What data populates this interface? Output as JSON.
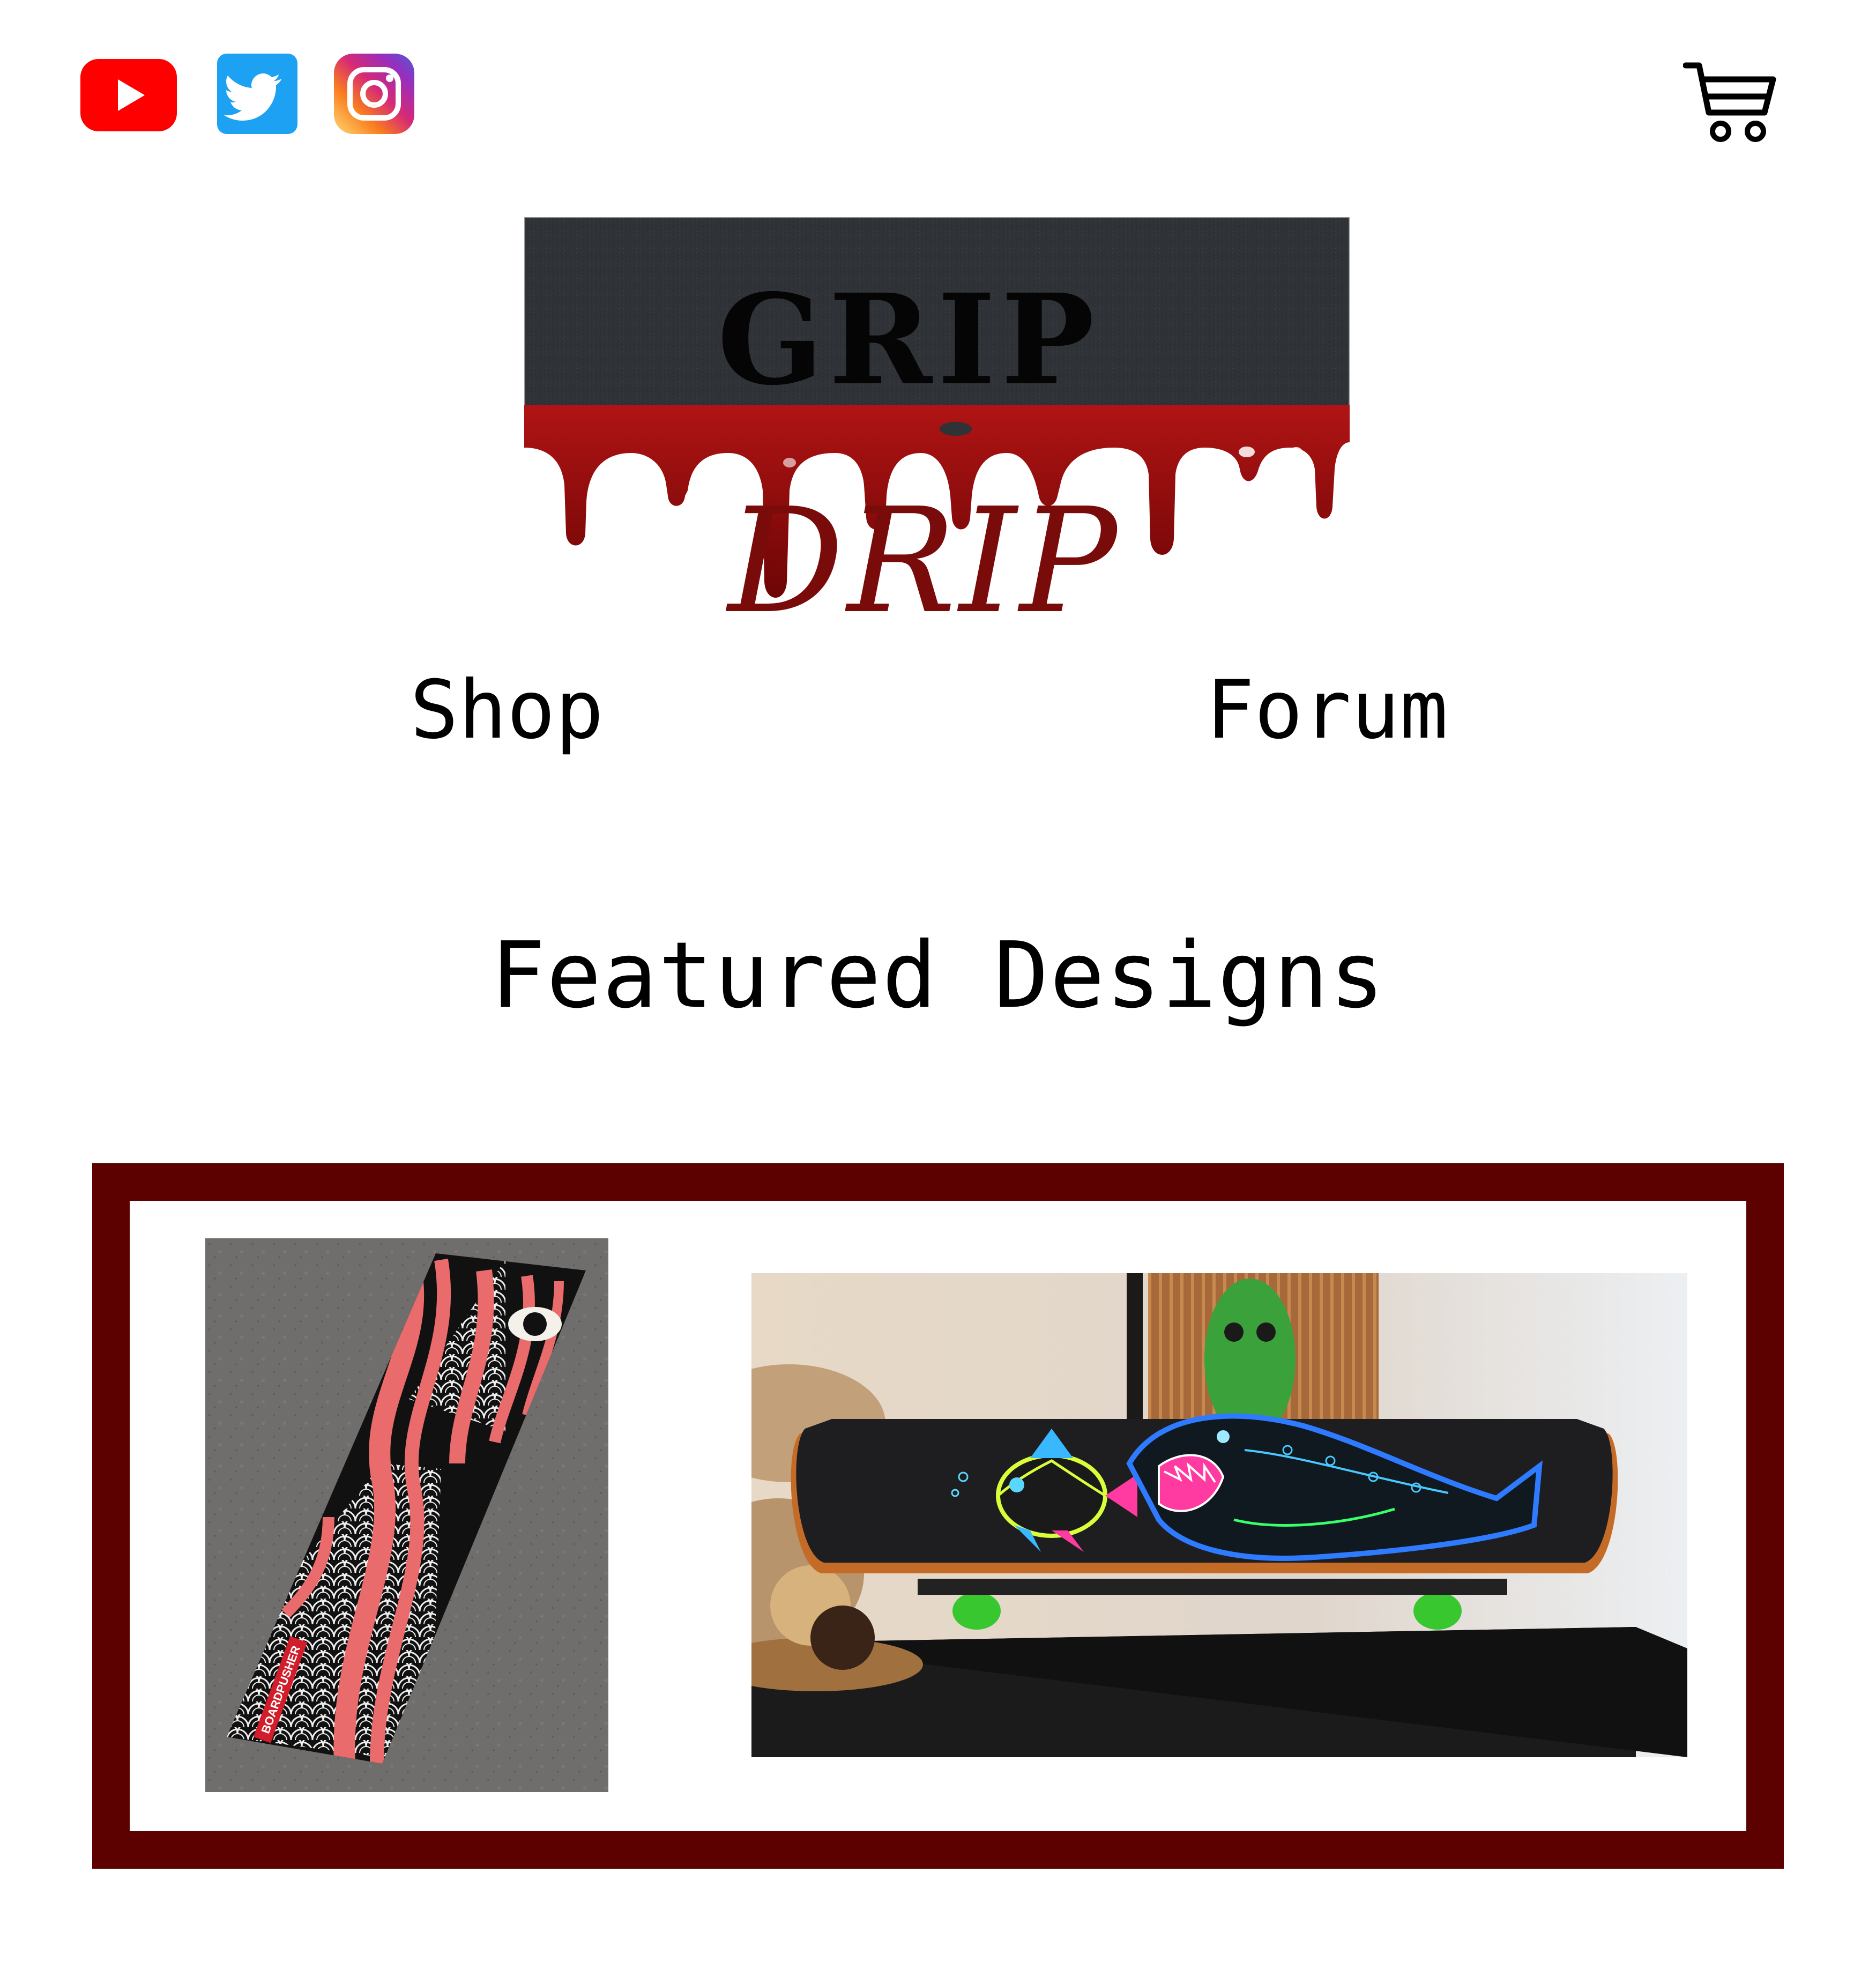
{
  "header": {
    "social": [
      {
        "icon": "youtube-icon",
        "color": "#ff0000"
      },
      {
        "icon": "twitter-icon",
        "color": "#1da1f2"
      },
      {
        "icon": "instagram-icon",
        "color": "#c13584"
      }
    ],
    "cart_icon": "shopping-cart-icon"
  },
  "logo": {
    "top_word": "GRIP",
    "bottom_word": "DRIP",
    "drip_color": "#8b0a0a",
    "grip_color": "#2d3033"
  },
  "nav": {
    "shop_label": "Shop",
    "forum_label": "Forum"
  },
  "featured": {
    "title": "Featured Designs",
    "frame_color": "#5c0000",
    "items": [
      {
        "brand_tag": "BOARDPUSHER"
      },
      {}
    ]
  }
}
